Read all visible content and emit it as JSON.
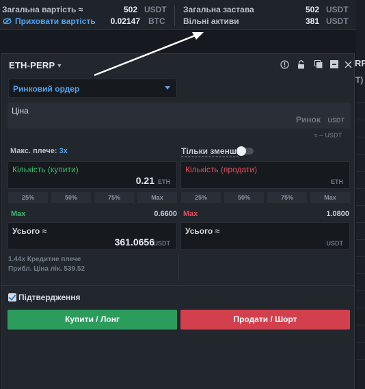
{
  "account": {
    "total_value_label": "Загальна вартість ≈",
    "total_value": "502",
    "total_value_unit": "USDT",
    "hide_value_label": "Приховати вартість",
    "btc_value": "0.02147",
    "btc_unit": "BTC",
    "total_collateral_label": "Загальна застава",
    "total_collateral": "502",
    "total_collateral_unit": "USDT",
    "free_assets_label": "Вільні активи",
    "free_assets": "381",
    "free_assets_unit": "USDT"
  },
  "background": {
    "right_text_1": "RP",
    "right_text_2": "T)"
  },
  "panel": {
    "symbol": "ETH-PERP",
    "icons": [
      "info-icon",
      "lock-icon",
      "popout-icon",
      "minimize-icon",
      "close-icon"
    ],
    "order_type": "Ринковий ордер",
    "price_label": "Ціна",
    "price_placeholder": "Ринок",
    "price_unit": "USDT",
    "price_approx": "≈ -- USDT",
    "max_leverage_label": "Макс. плече:",
    "max_leverage_value": "3x",
    "reduce_only_label": "Тільки зменш.",
    "reduce_only_on": false,
    "buy": {
      "qty_label": "Кількість (купити)",
      "qty_value": "0.21",
      "qty_unit": "ETH",
      "pct_buttons": [
        "25%",
        "50%",
        "75%",
        "Max"
      ],
      "max_label": "Max",
      "max_value": "0.6600",
      "total_label": "Усього",
      "total_value": "361.0656",
      "total_unit": "USDT"
    },
    "sell": {
      "qty_label": "Кількість (продати)",
      "qty_value": "",
      "qty_unit": "ETH",
      "pct_buttons": [
        "25%",
        "50%",
        "75%",
        "Max"
      ],
      "max_label": "Max",
      "max_value": "1.0800",
      "total_label": "Усього",
      "total_value": "",
      "total_unit": "USDT"
    },
    "info_leverage": "1.44x Кредитне плече",
    "info_liq_price": "Прибл. Ціна лік. 539.52",
    "confirm_label": "Підтвердження",
    "confirm_checked": true,
    "buy_button": "Купити / Лонг",
    "sell_button": "Продати / Шорт"
  },
  "colors": {
    "accent": "#4fa3f0",
    "buy": "#2b9c5c",
    "sell": "#d2404d",
    "buy_text": "#3dbb6f",
    "sell_text": "#e0505c"
  }
}
